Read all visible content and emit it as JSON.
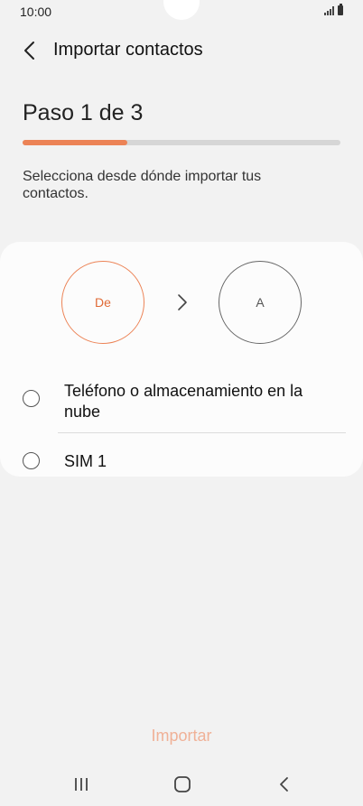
{
  "status_bar": {
    "time": "10:00"
  },
  "app_bar": {
    "title": "Importar contactos",
    "back_icon": "back-arrow-icon"
  },
  "step": {
    "title": "Paso 1 de 3",
    "progress": 0.33
  },
  "instruction": "Selecciona desde dónde importar tus contactos.",
  "flow": {
    "from_label": "De",
    "to_label": "A"
  },
  "options": [
    {
      "label": "Teléfono o almacenamiento en la nube",
      "selected": false
    },
    {
      "label": "SIM 1",
      "selected": false
    }
  ],
  "import_button": {
    "label": "Importar",
    "enabled": false
  },
  "colors": {
    "accent": "#ec8356",
    "accent_disabled": "#f0b197"
  }
}
